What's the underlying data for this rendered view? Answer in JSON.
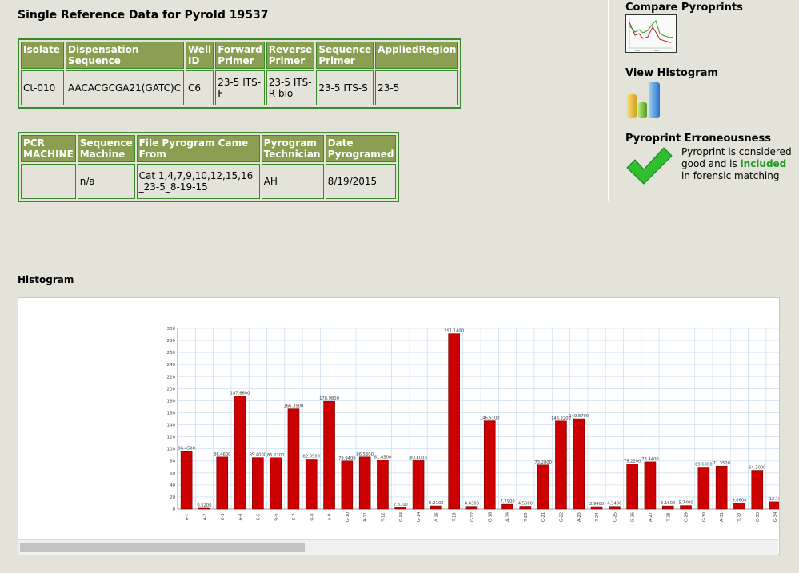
{
  "page": {
    "title": "Single Reference Data for PyroId 19537"
  },
  "table1": {
    "headers": [
      "Isolate",
      "Dispensation Sequence",
      "Well ID",
      "Forward Primer",
      "Reverse Primer",
      "Sequence Primer",
      "AppliedRegion"
    ],
    "row": [
      "Ct-010",
      "AACACGCGA21(GATC)C",
      "C6",
      "23-5 ITS-F",
      "23-5 ITS-R-bio",
      "23-5 ITS-S",
      "23-5"
    ]
  },
  "table2": {
    "headers": [
      "PCR MACHINE",
      "Sequence Machine",
      "File Pyrogram Came From",
      "Pyrogram Technician",
      "Date Pyrogramed"
    ],
    "row": [
      "",
      "n/a",
      "Cat 1,4,7,9,10,12,15,16_23-5_8-19-15",
      "AH",
      "8/19/2015"
    ]
  },
  "sidebar": {
    "compare_label": "Compare Pyroprints",
    "view_hist_label": "View Histogram",
    "err_heading": "Pyroprint Erroneousness",
    "err_text_1": "Pyroprint is considered good and is ",
    "err_text_included": "included",
    "err_text_2": " in forensic matching"
  },
  "histogram": {
    "heading": "Histogram"
  },
  "chart_data": {
    "type": "bar",
    "ylim": [
      0,
      300
    ],
    "yticks": [
      0,
      20,
      40,
      60,
      80,
      100,
      120,
      140,
      160,
      180,
      200,
      220,
      240,
      260,
      280,
      300
    ],
    "categories": [
      "A-1",
      "A-2",
      "C-3",
      "A-4",
      "C-5",
      "G-6",
      "C-7",
      "G-8",
      "A-9",
      "G-10",
      "A-11",
      "T-12",
      "C-13",
      "G-14",
      "A-15",
      "T-16",
      "C-17",
      "G-18",
      "A-19",
      "T-20",
      "C-21",
      "G-22",
      "A-23",
      "T-24",
      "C-25",
      "G-26",
      "A-27",
      "T-28",
      "C-29",
      "G-30",
      "A-31",
      "T-32",
      "C-33",
      "G-34"
    ],
    "values": [
      96.45,
      0.52,
      86.46,
      187.66,
      85.4,
      85.22,
      166.35,
      82.95,
      178.98,
      79.94,
      86.56,
      81.45,
      2.81,
      80.4,
      5.21,
      291.14,
      4.43,
      146.51,
      7.79,
      4.59,
      73.28,
      146.22,
      149.87,
      3.94,
      4.34,
      75.22,
      78.44,
      5.16,
      5.74,
      69.63,
      71.35,
      9.86,
      64.3,
      12.1
    ],
    "labels": [
      "96.4500",
      "0.5200",
      "86.4600",
      "187.6600",
      "85.4000",
      "85.2200",
      "166.3500",
      "82.9500",
      "178.9800",
      "79.9400",
      "86.5600",
      "81.4500",
      "2.8100",
      "80.4000",
      "5.2100",
      "291.1400",
      "4.4300",
      "146.5100",
      "7.7900",
      "4.5900",
      "73.2800",
      "146.2200",
      "149.8700",
      "3.9400",
      "4.3400",
      "75.2200",
      "78.4400",
      "5.1600",
      "5.7400",
      "69.6300",
      "71.3500",
      "9.8600",
      "64.3000",
      "12.10"
    ],
    "bar_color": "#cc0000",
    "grid": true
  }
}
